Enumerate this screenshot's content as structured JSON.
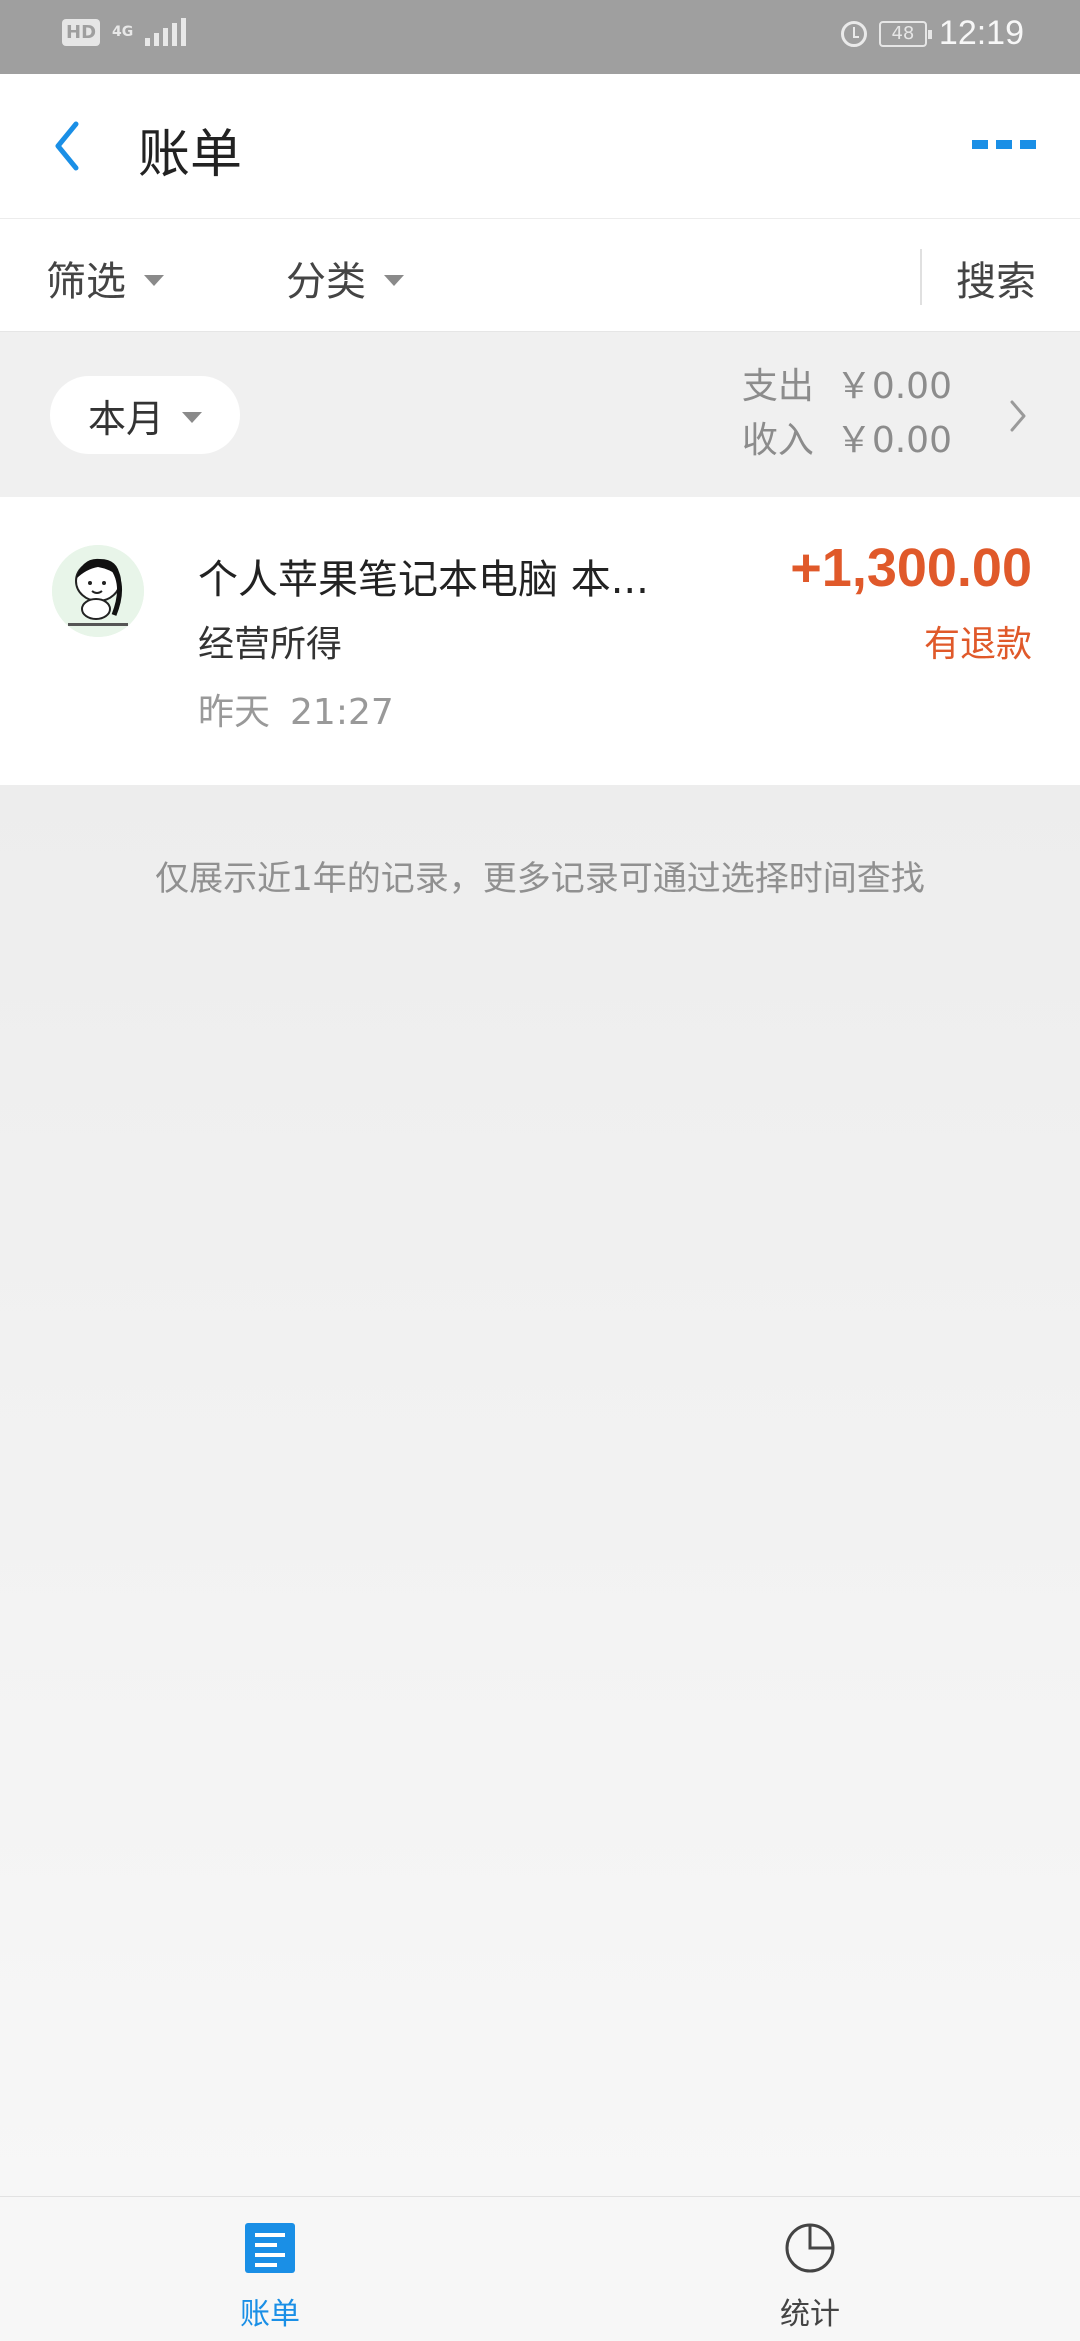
{
  "status_bar": {
    "hd_label": "HD",
    "network_label": "4G",
    "battery_level": "48",
    "time": "12:19"
  },
  "header": {
    "title": "账单",
    "back_icon": "chevron-left-icon",
    "more_icon": "more-dots-icon",
    "accent_color": "#1a8fe6"
  },
  "filter_bar": {
    "filter_label": "筛选",
    "category_label": "分类",
    "search_label": "搜索"
  },
  "summary": {
    "period_label": "本月",
    "expense_label": "支出",
    "expense_value": "￥0.00",
    "income_label": "收入",
    "income_value": "￥0.00"
  },
  "records": [
    {
      "title": "个人苹果笔记本电脑 本...",
      "category": "经营所得",
      "date": "昨天",
      "time": "21:27",
      "amount": "+1,300.00",
      "tag": "有退款",
      "amount_color": "#e0592a"
    }
  ],
  "footer_note": "仅展示近1年的记录，更多记录可通过选择时间查找",
  "tabs": [
    {
      "label": "账单",
      "icon": "bill-icon",
      "active": true
    },
    {
      "label": "统计",
      "icon": "pie-chart-icon",
      "active": false
    }
  ]
}
